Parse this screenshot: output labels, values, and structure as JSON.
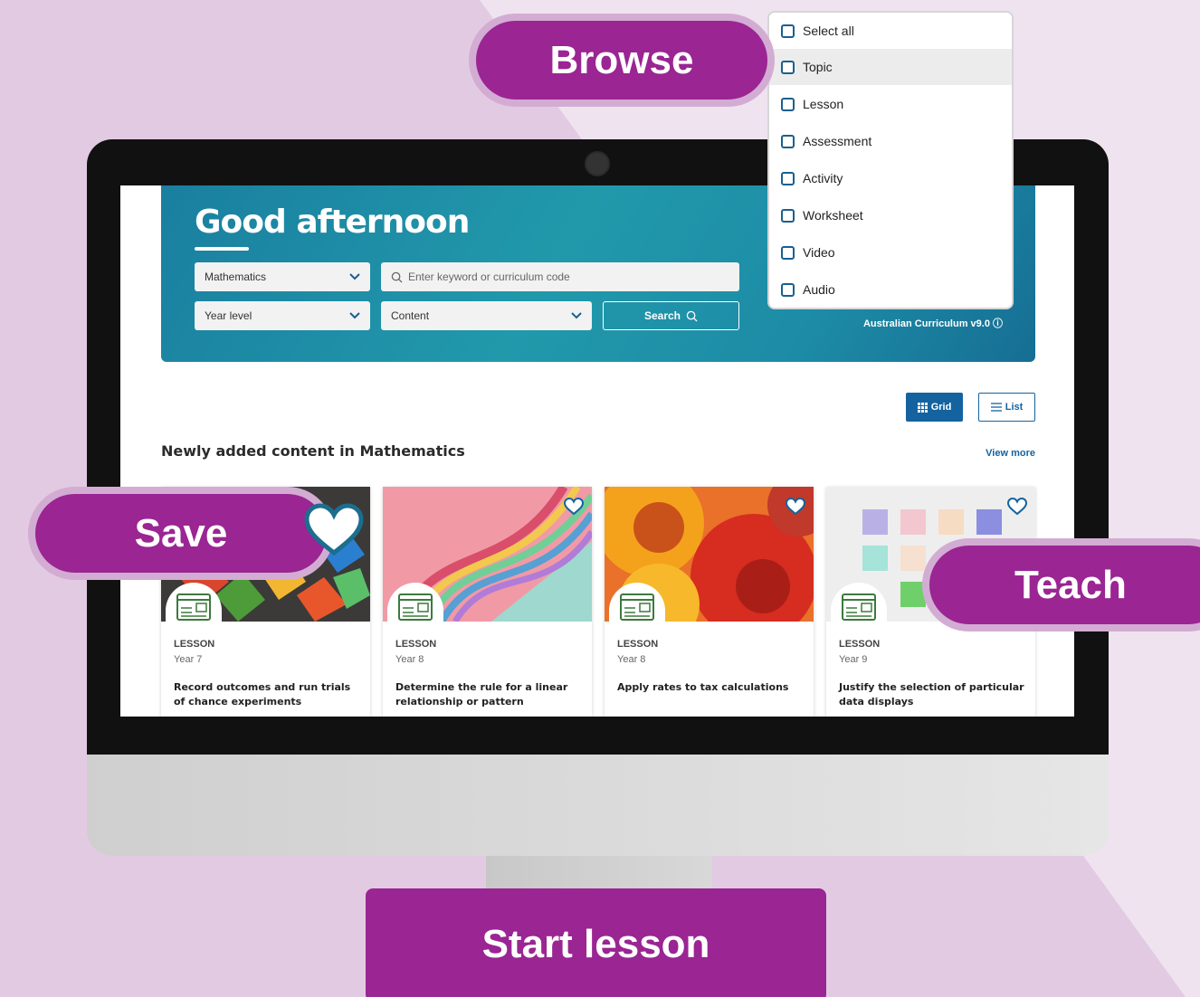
{
  "greeting": "Good afternoon",
  "filters": {
    "subject": "Mathematics",
    "year_level": "Year level",
    "content": "Content",
    "search_placeholder": "Enter keyword or curriculum code",
    "search_button": "Search"
  },
  "curriculum_label": "Australian Curriculum v9.0 ⓘ",
  "view_toggle": {
    "grid": "Grid",
    "list": "List"
  },
  "section": {
    "title": "Newly added content in Mathematics",
    "view_more": "View more"
  },
  "cards": [
    {
      "type": "LESSON",
      "year": "Year 7",
      "title": "Record outcomes and run trials of chance experiments"
    },
    {
      "type": "LESSON",
      "year": "Year 8",
      "title": "Determine the rule for a linear relationship or pattern"
    },
    {
      "type": "LESSON",
      "year": "Year 8",
      "title": "Apply rates to tax calculations"
    },
    {
      "type": "LESSON",
      "year": "Year 9",
      "title": "Justify the selection of particular data displays"
    }
  ],
  "dropdown_options": [
    "Select all",
    "Topic",
    "Lesson",
    "Assessment",
    "Activity",
    "Worksheet",
    "Video",
    "Audio"
  ],
  "callouts": {
    "browse": "Browse",
    "save": "Save",
    "teach": "Teach",
    "start": "Start lesson"
  },
  "colors": {
    "brand_purple": "#9a2593",
    "hero_teal": "#1d8ba6",
    "link_blue": "#1463a0"
  }
}
